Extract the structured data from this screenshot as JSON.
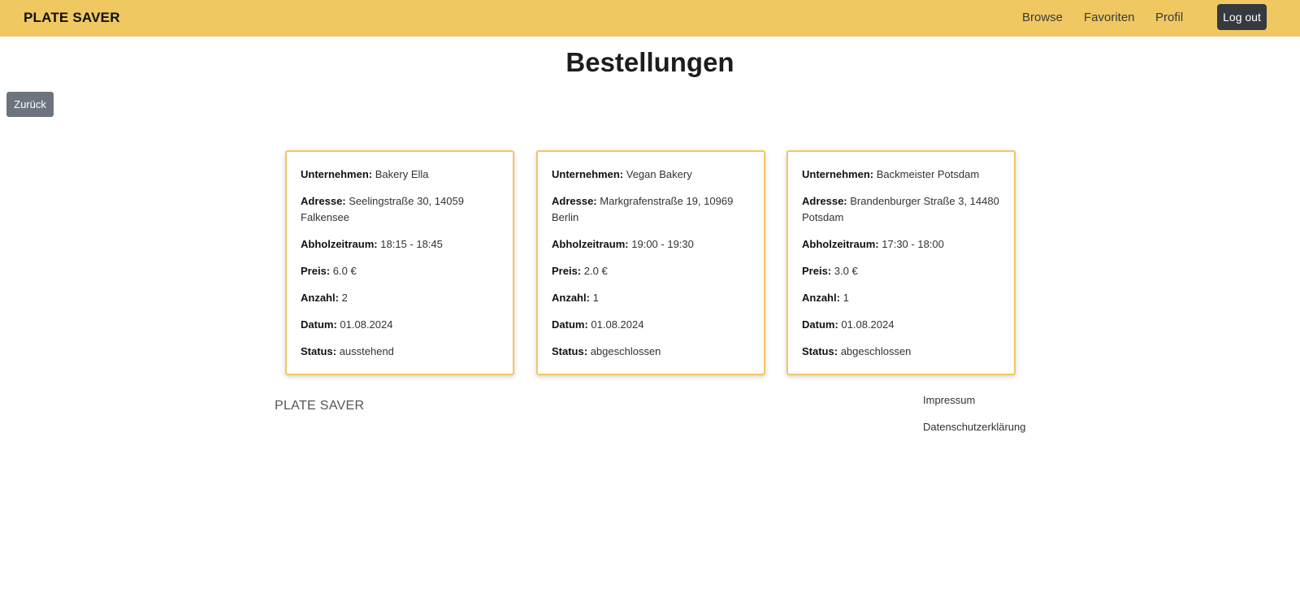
{
  "navbar": {
    "brand": "PLATE SAVER",
    "links": [
      "Browse",
      "Favoriten",
      "Profil"
    ],
    "logout_label": "Log out",
    "background": "#f0c862"
  },
  "main": {
    "title": "Bestellungen",
    "back_label": "Zurück",
    "labels": {
      "company": "Unternehmen:",
      "address": "Adresse:",
      "pickup": "Abholzeitraum:",
      "price": "Preis:",
      "quantity": "Anzahl:",
      "date": "Datum:",
      "status": "Status:"
    },
    "orders": [
      {
        "company": "Bakery Ella",
        "address": "Seelingstraße 30, 14059 Falkensee",
        "pickup": "18:15 - 18:45",
        "price": "6.0 €",
        "quantity": "2",
        "date": "01.08.2024",
        "status": "ausstehend"
      },
      {
        "company": "Vegan Bakery",
        "address": "Markgrafenstraße 19, 10969 Berlin",
        "pickup": "19:00 - 19:30",
        "price": "2.0 €",
        "quantity": "1",
        "date": "01.08.2024",
        "status": "abgeschlossen"
      },
      {
        "company": "Backmeister Potsdam",
        "address": "Brandenburger Straße 3, 14480 Potsdam",
        "pickup": "17:30 - 18:00",
        "price": "3.0 €",
        "quantity": "1",
        "date": "01.08.2024",
        "status": "abgeschlossen"
      }
    ],
    "card_border_color": "#f0c862"
  },
  "footer": {
    "brand": "PLATE SAVER",
    "links": [
      "Impressum",
      "Datenschutzerklärung"
    ]
  }
}
